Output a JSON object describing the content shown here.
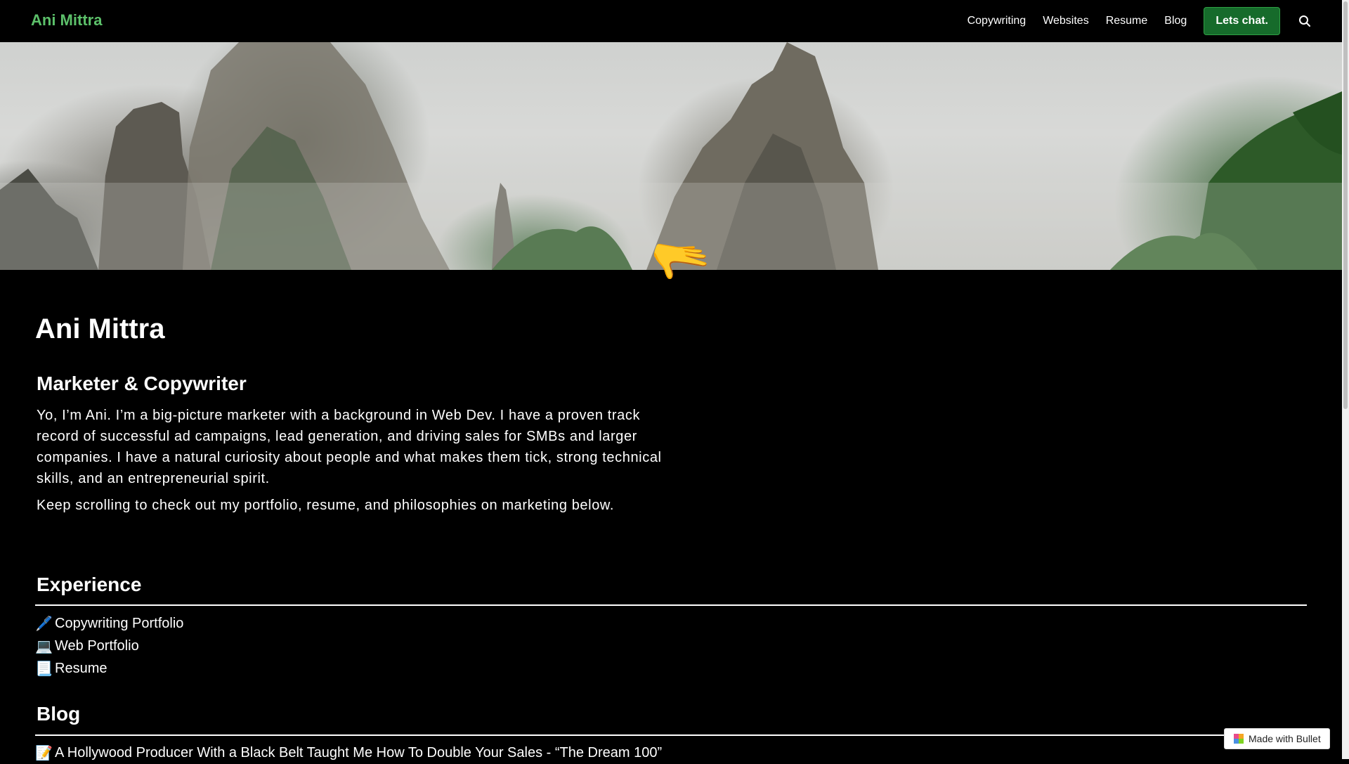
{
  "brand": "Ani Mittra",
  "nav": {
    "items": [
      "Copywriting",
      "Websites",
      "Resume",
      "Blog"
    ],
    "cta_label": "Lets chat."
  },
  "hero": {
    "image": "misty-mountain-peaks",
    "hand_emoji": "🫳"
  },
  "profile": {
    "name": "Ani Mittra",
    "headline": "Marketer & Copywriter",
    "bio": "Yo, I’m Ani. I’m a big-picture marketer with a background in Web Dev. I have a proven track record of successful ad campaigns, lead generation, and driving sales for SMBs and larger companies. I have a natural curiosity about people and what makes them tick, strong technical skills, and an entrepreneurial spirit.",
    "scroll_note": "Keep scrolling to check out my portfolio, resume, and philosophies on marketing below."
  },
  "experience": {
    "heading": "Experience",
    "items": [
      {
        "emoji": "🖊️",
        "label": "Copywriting Portfolio"
      },
      {
        "emoji": "💻",
        "label": "Web Portfolio"
      },
      {
        "emoji": "📃",
        "label": "Resume"
      }
    ]
  },
  "blog": {
    "heading": "Blog",
    "items": [
      {
        "emoji": "📝",
        "label": "A Hollywood Producer With a Black Belt Taught Me How To Double Your Sales - “The Dream 100”"
      }
    ]
  },
  "badge": {
    "label": "Made with Bullet"
  },
  "colors": {
    "brand": "#5cc06a",
    "cta_bg": "#166b2b",
    "background": "#000000"
  }
}
